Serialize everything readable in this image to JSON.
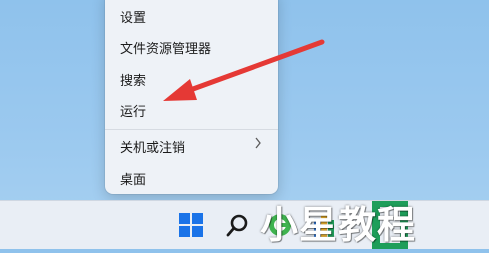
{
  "context_menu": {
    "items": [
      {
        "label": "设置"
      },
      {
        "label": "文件资源管理器"
      },
      {
        "label": "搜索"
      },
      {
        "label": "运行"
      },
      {
        "label": "关机或注销",
        "submenu_indicator": "chevron-right-icon"
      },
      {
        "label": "桌面"
      }
    ]
  },
  "annotation": {
    "arrow_color": "#e53935"
  },
  "taskbar": {
    "icons": [
      "windows-start-icon",
      "search-icon",
      "edge-browser-icon",
      "app-icon",
      "green-app-icon"
    ]
  },
  "watermark": {
    "text": "小星教程"
  },
  "colors": {
    "accent": "#1a73e8",
    "arrow": "#e53935",
    "menu_bg": "#eef2f7"
  }
}
